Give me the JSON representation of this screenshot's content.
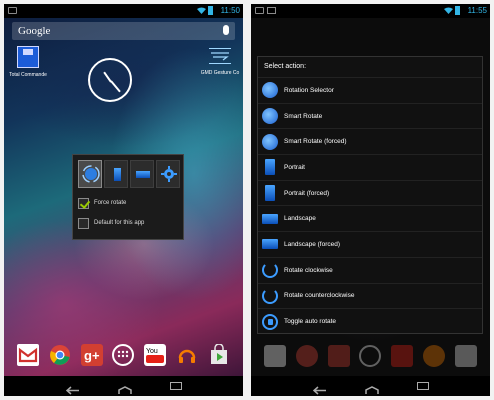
{
  "left_screen": {
    "status_time": "11:50",
    "search_label": "Google",
    "desktop_icons": [
      {
        "label": "Total Commande",
        "icon": "floppy-icon"
      },
      {
        "label": "GMD Gesture Co",
        "icon": "gesture-icon"
      }
    ],
    "dialog": {
      "rotation_buttons": [
        "rotation-selector-icon",
        "portrait-icon",
        "landscape-icon",
        "settings-icon"
      ],
      "force_rotate_label": "Force rotate",
      "force_rotate_checked": true,
      "default_app_label": "Default for this app",
      "default_app_checked": false
    },
    "dock_apps": [
      "gmail-icon",
      "chrome-icon",
      "google-plus-icon",
      "app-drawer-icon",
      "youtube-icon",
      "play-music-icon",
      "play-store-icon"
    ]
  },
  "right_screen": {
    "status_time": "11:55",
    "menu_title": "Select action:",
    "menu_items": [
      {
        "label": "Rotation Selector",
        "icon": "rotation-selector-icon"
      },
      {
        "label": "Smart Rotate",
        "icon": "smart-rotate-icon"
      },
      {
        "label": "Smart Rotate (forced)",
        "icon": "smart-rotate-forced-icon"
      },
      {
        "label": "Portrait",
        "icon": "portrait-icon"
      },
      {
        "label": "Portrait (forced)",
        "icon": "portrait-forced-icon"
      },
      {
        "label": "Landscape",
        "icon": "landscape-icon"
      },
      {
        "label": "Landscape (forced)",
        "icon": "landscape-forced-icon"
      },
      {
        "label": "Rotate clockwise",
        "icon": "rotate-clockwise-icon"
      },
      {
        "label": "Rotate counterclockwise",
        "icon": "rotate-counterclockwise-icon"
      },
      {
        "label": "Toggle auto rotate",
        "icon": "toggle-auto-rotate-icon"
      }
    ]
  },
  "colors": {
    "accent": "#33b5e5",
    "icon_blue": "#3c9cff",
    "check_green": "#99cc00"
  }
}
